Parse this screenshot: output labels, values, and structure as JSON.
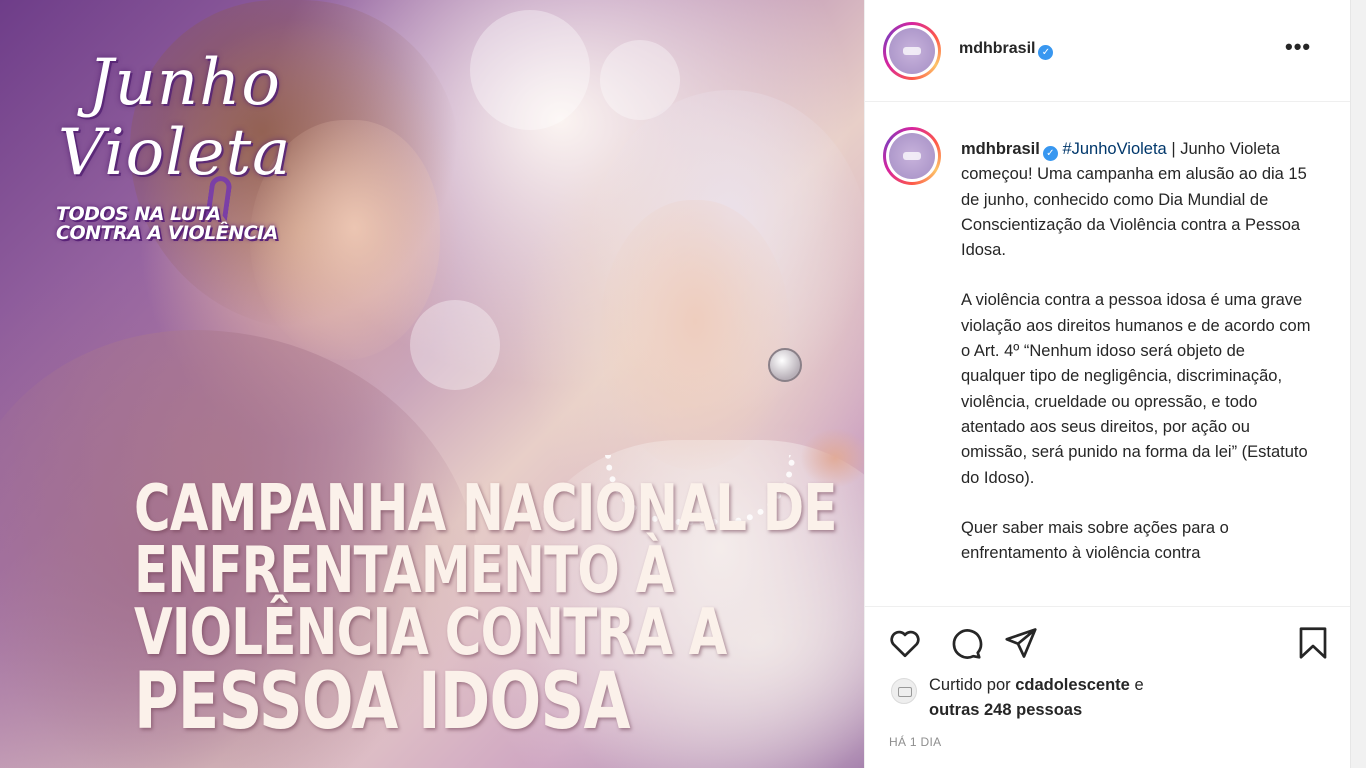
{
  "post_image": {
    "campaign_title_line1": "Junho",
    "campaign_title_line2": "Violeta",
    "tagline_line1": "TODOS NA LUTA",
    "tagline_line2": "CONTRA A VIOLÊNCIA",
    "headline": [
      "CAMPANHA NACIONAL DE",
      "ENFRENTAMENTO À",
      "VIOLÊNCIA CONTRA A",
      "PESSOA IDOSA"
    ]
  },
  "header": {
    "username": "mdhbrasil",
    "more_icon": "•••"
  },
  "caption": {
    "username": "mdhbrasil",
    "hashtag": "#JunhoVioleta",
    "paragraph1_rest": " | Junho Violeta começou! Uma campanha em alusão ao dia 15 de junho, conhecido como Dia Mundial de Conscientização da Violência contra a Pessoa Idosa.",
    "paragraph2": "A violência contra a pessoa idosa é uma grave violação aos direitos humanos e de acordo com o Art. 4º “Nenhum idoso será objeto de qualquer tipo de negligência, discriminação, violência, crueldade ou opressão, e todo atentado aos seus direitos, por ação ou omissão, será punido na forma da lei” (Estatuto do Idoso).",
    "paragraph3": "Quer saber mais sobre ações para o enfrentamento à violência contra"
  },
  "likes": {
    "prefix": "Curtido por ",
    "user": "cdadolescente",
    "middle": " e",
    "others": "outras 248 pessoas"
  },
  "timestamp": "HÁ 1 DIA",
  "colors": {
    "verified": "#3897f0",
    "hashtag": "#00376b",
    "text": "#262626",
    "muted": "#8e8e8e"
  }
}
